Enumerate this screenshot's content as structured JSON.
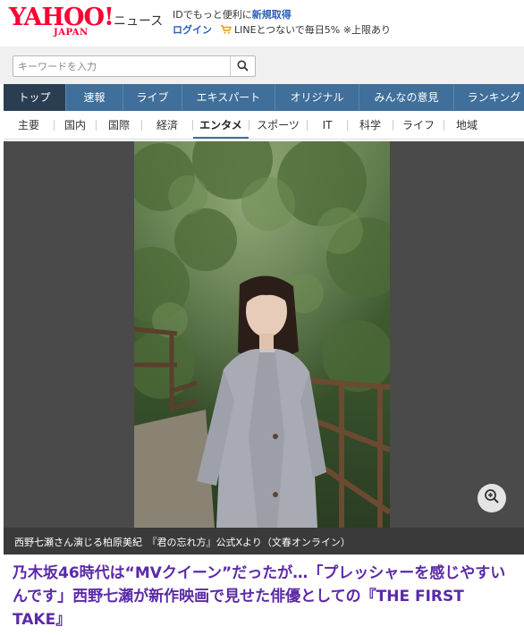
{
  "header": {
    "logo_main": "YAHOO!",
    "logo_sub": "JAPAN",
    "service": "ニュース",
    "promo_line1_prefix": "IDでもっと便利に",
    "promo_line1_strong": "新規取得",
    "login": "ログイン",
    "promo_line2": "LINEとつないで毎日5% ※上限あり"
  },
  "search": {
    "placeholder": "キーワードを入力"
  },
  "main_nav": {
    "items": [
      {
        "label": "トップ"
      },
      {
        "label": "速報"
      },
      {
        "label": "ライブ"
      },
      {
        "label": "エキスパート"
      },
      {
        "label": "オリジナル"
      },
      {
        "label": "みんなの意見"
      },
      {
        "label": "ランキング"
      }
    ],
    "active_index": 0
  },
  "sub_nav": {
    "items": [
      {
        "label": "主要"
      },
      {
        "label": "国内"
      },
      {
        "label": "国際"
      },
      {
        "label": "経済"
      },
      {
        "label": "エンタメ"
      },
      {
        "label": "スポーツ"
      },
      {
        "label": "IT"
      },
      {
        "label": "科学"
      },
      {
        "label": "ライフ"
      },
      {
        "label": "地域"
      }
    ],
    "active_index": 4
  },
  "photo": {
    "caption": "西野七瀬さん演じる柏原美紀　『君の忘れ方』公式Xより（文春オンライン）"
  },
  "article": {
    "headline": "乃木坂46時代は“MVクイーン”だったが…「プレッシャーを感じやすいんです」西野七瀬が新作映画で見せた俳優としての『THE FIRST TAKE』"
  },
  "colors": {
    "brand_red": "#ff0033",
    "nav_blue": "#3f6f9a",
    "nav_active": "#2b3d50",
    "link_blue": "#2b5fb8",
    "headline_purple": "#5b2aa8"
  },
  "icons": {
    "search": "search-icon",
    "cart": "cart-icon",
    "zoom": "zoom-in-icon"
  }
}
